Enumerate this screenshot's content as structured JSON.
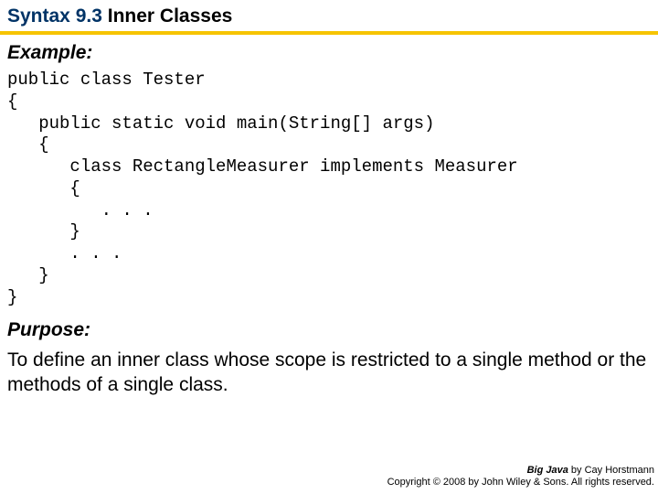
{
  "title": {
    "prefix": "Syntax 9.3",
    "suffix": " Inner Classes"
  },
  "example": {
    "label": "Example:",
    "code": "public class Tester\n{\n   public static void main(String[] args)\n   {\n      class RectangleMeasurer implements Measurer\n      {\n         . . .\n      }\n      . . .\n   }\n}"
  },
  "purpose": {
    "label": "Purpose:",
    "text": "To define an inner class whose scope is restricted to a single method or the methods of a single class."
  },
  "footer": {
    "book": "Big Java",
    "author": " by Cay Horstmann",
    "copyright": "Copyright © 2008 by John Wiley & Sons. All rights reserved."
  }
}
